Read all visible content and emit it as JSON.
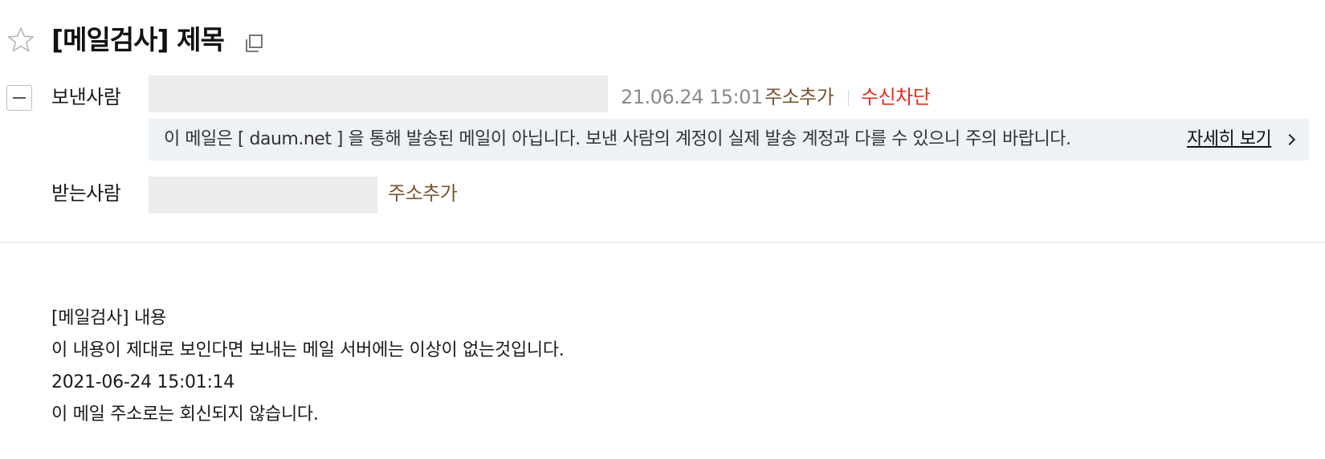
{
  "header": {
    "subject": "[메일검사] 제목",
    "star_icon": "star-outline-icon",
    "copy_icon": "copy-icon"
  },
  "sender": {
    "label": "보낸사람",
    "date": "21.06.24 15:01",
    "add_address": "주소추가",
    "block": "수신차단"
  },
  "warning": {
    "text": "이 메일은 [ daum.net ] 을 통해 발송된 메일이 아닙니다. 보낸 사람의 계정이 실제 발송 계정과 다를 수 있으니 주의 바랍니다.",
    "detail_link": "자세히 보기"
  },
  "recipient": {
    "label": "받는사람",
    "add_address": "주소추가"
  },
  "body": {
    "lines": [
      "[메일검사] 내용",
      "이 내용이 제대로 보인다면 보내는 메일 서버에는 이상이 없는것입니다.",
      "2021-06-24 15:01:14",
      "이 메일 주소로는 회신되지 않습니다."
    ]
  },
  "colors": {
    "link_brown": "#7a5530",
    "block_red": "#e0301e",
    "warning_bg": "#eef1f5",
    "redacted_bg": "#ececec"
  }
}
